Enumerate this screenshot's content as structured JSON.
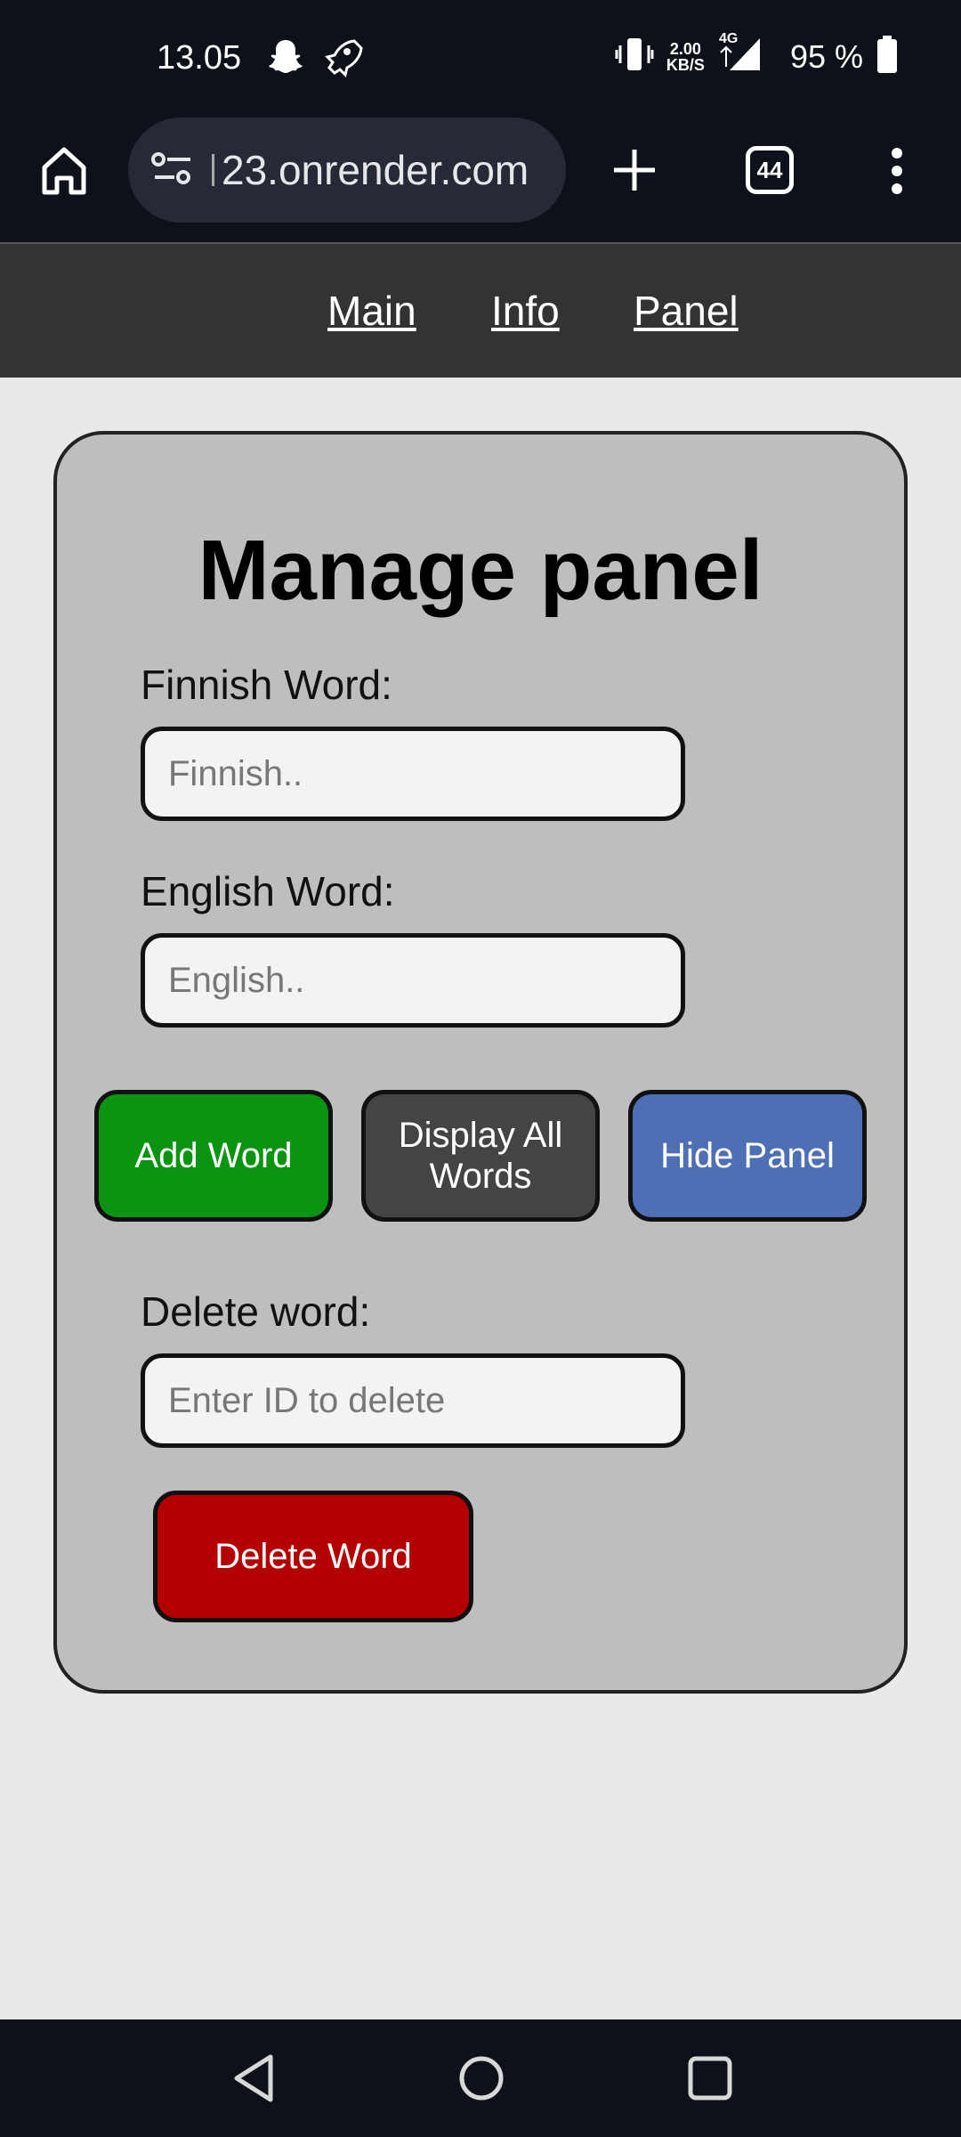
{
  "status_bar": {
    "time": "13.05",
    "net_speed_value": "2.00",
    "net_speed_unit": "KB/S",
    "network_type": "4G",
    "battery": "95 %",
    "icons": [
      "snapchat-icon",
      "rocket-icon",
      "vibrate-icon",
      "signal-icon",
      "battery-icon"
    ]
  },
  "browser": {
    "url": "23.onrender.com",
    "tab_count": "44"
  },
  "nav": {
    "links": [
      "Main",
      "Info",
      "Panel"
    ]
  },
  "panel": {
    "title": "Manage panel",
    "finnish_label": "Finnish Word:",
    "finnish_placeholder": "Finnish..",
    "english_label": "English Word:",
    "english_placeholder": "English..",
    "buttons": {
      "add": "Add Word",
      "display_line1": "Display All",
      "display_line2": "Words",
      "hide": "Hide Panel"
    },
    "delete_label": "Delete word:",
    "delete_placeholder": "Enter ID to delete",
    "delete_button": "Delete Word"
  },
  "colors": {
    "add": "#0b9412",
    "display": "#444444",
    "hide": "#4f6fb5",
    "delete": "#b50000",
    "panel_bg": "#bebebe",
    "nav_bg": "#333333"
  }
}
